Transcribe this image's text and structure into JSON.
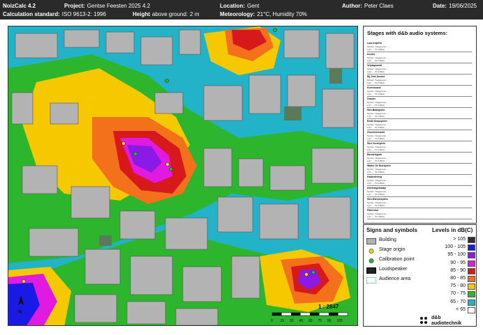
{
  "header": {
    "app": "NoizCalc 4.2",
    "project_label": "Project:",
    "project_value": "Gentse Feesten 2025 4.2",
    "location_label": "Location:",
    "location_value": "Gent",
    "author_label": "Author:",
    "author_value": "Peter Claes",
    "date_label": "Date:",
    "date_value": "19/06/2025",
    "calc_label": "Calculation standard:",
    "calc_value": "ISO 9613-2: 1996",
    "height_label": "Height",
    "height_rest": "above ground:",
    "height_value": "2 m",
    "meteo_label": "Meteorology:",
    "meteo_value": "21°C, Humidity 70%"
  },
  "stages": {
    "title": "Stages with d&b audio systems:",
    "items": [
      {
        "name": "Laurentplein",
        "line1": "System: Stagename, ...",
        "line2": "L(A): ... 70.0 dB(A)"
      },
      {
        "name": "Kouter",
        "line1": "System: Stagename, ...",
        "line2": "L(A): ... 70.0 dB(A)"
      },
      {
        "name": "Vrijdagmarkt",
        "line1": "System: Stagename, ...",
        "line2": "L(A): ... 70.0 dB(A)"
      },
      {
        "name": "Bij Sint-Jacobs",
        "line1": "System: Stagename, ...",
        "line2": "L(A): ... 70.0 dB(A)"
      },
      {
        "name": "Korenmarkt",
        "line1": "System: Stagename, ...",
        "line2": "L(A): ... 70.0 dB(A)"
      },
      {
        "name": "Graslei",
        "line1": "System: Stagename, ...",
        "line2": "L(A): ... 70.0 dB(A)"
      },
      {
        "name": "Sint-Baafsplein",
        "line1": "System: Stagename, ...",
        "line2": "L(A): ... 70.0 dB(A)"
      },
      {
        "name": "Emile Braunplein",
        "line1": "System: Stagename, ...",
        "line2": "L(A): ... 70.0 dB(A)"
      },
      {
        "name": "Groentenmarkt",
        "line1": "System: Stagename, ...",
        "line2": "L(A): ... 70.0 dB(A)"
      },
      {
        "name": "Sint-Veerleplein",
        "line1": "System: Stagename, ...",
        "line2": "L(A): ... 70.0 dB(A)"
      },
      {
        "name": "Baudelopark",
        "line1": "System: Stagename, ...",
        "line2": "L(A): ... 70.0 dB(A)"
      },
      {
        "name": "Walter De Buckplein",
        "line1": "System: Stagename, ...",
        "line2": "L(A): ... 70.0 dB(A)"
      },
      {
        "name": "Kalandeberg",
        "line1": "System: Stagename, ...",
        "line2": "L(A): ... 70.0 dB(A)"
      },
      {
        "name": "Hoefslagstraatje",
        "line1": "System: Stagename, ...",
        "line2": "L(A): ... 70.0 dB(A)"
      },
      {
        "name": "Sint-Michielsplein",
        "line1": "System: Stagename, ...",
        "line2": "L(A): ... 70.0 dB(A)"
      },
      {
        "name": "Patershol",
        "line1": "System: Stagename, ...",
        "line2": "L(A): ... 70.0 dB(A)"
      }
    ]
  },
  "signs": {
    "title": "Signs and symbols",
    "items": [
      {
        "label": "Building",
        "icon": "building-swatch"
      },
      {
        "label": "Stage origin",
        "icon": "yellow-dot"
      },
      {
        "label": "Calibration point",
        "icon": "green-dot"
      },
      {
        "label": "Loudspeaker",
        "icon": "black-bar"
      },
      {
        "label": "Audience area",
        "icon": "dotted-outline"
      }
    ]
  },
  "levels": {
    "title": "Levels in dB(C)",
    "items": [
      {
        "label": "> 105",
        "color": "#2f2f2f"
      },
      {
        "label": "100 - 105",
        "color": "#1a1ae6"
      },
      {
        "label": "95 - 100",
        "color": "#8a1ae6"
      },
      {
        "label": "90 - 95",
        "color": "#e01ae0"
      },
      {
        "label": "85 - 90",
        "color": "#d7191c"
      },
      {
        "label": "80 - 85",
        "color": "#f4711c"
      },
      {
        "label": "75 - 80",
        "color": "#f5c800"
      },
      {
        "label": "70 - 75",
        "color": "#2db52d"
      },
      {
        "label": "65 - 70",
        "color": "#22b3c8"
      },
      {
        "label": "< 65",
        "color": "#ffffff"
      }
    ]
  },
  "map": {
    "scale_label": "1 : 2847",
    "scale_ticks": [
      "0",
      "15",
      "30",
      "45",
      "60",
      "75",
      "90",
      "105"
    ],
    "north": "N"
  },
  "logo": {
    "line1": "d&b",
    "line2": "audiotechnik"
  },
  "colors": {
    "header_bg": "#2a2a2a",
    "building": "#b3b3b3",
    "building_dark": "#5a7a5a",
    "panel_border": "#333333"
  }
}
